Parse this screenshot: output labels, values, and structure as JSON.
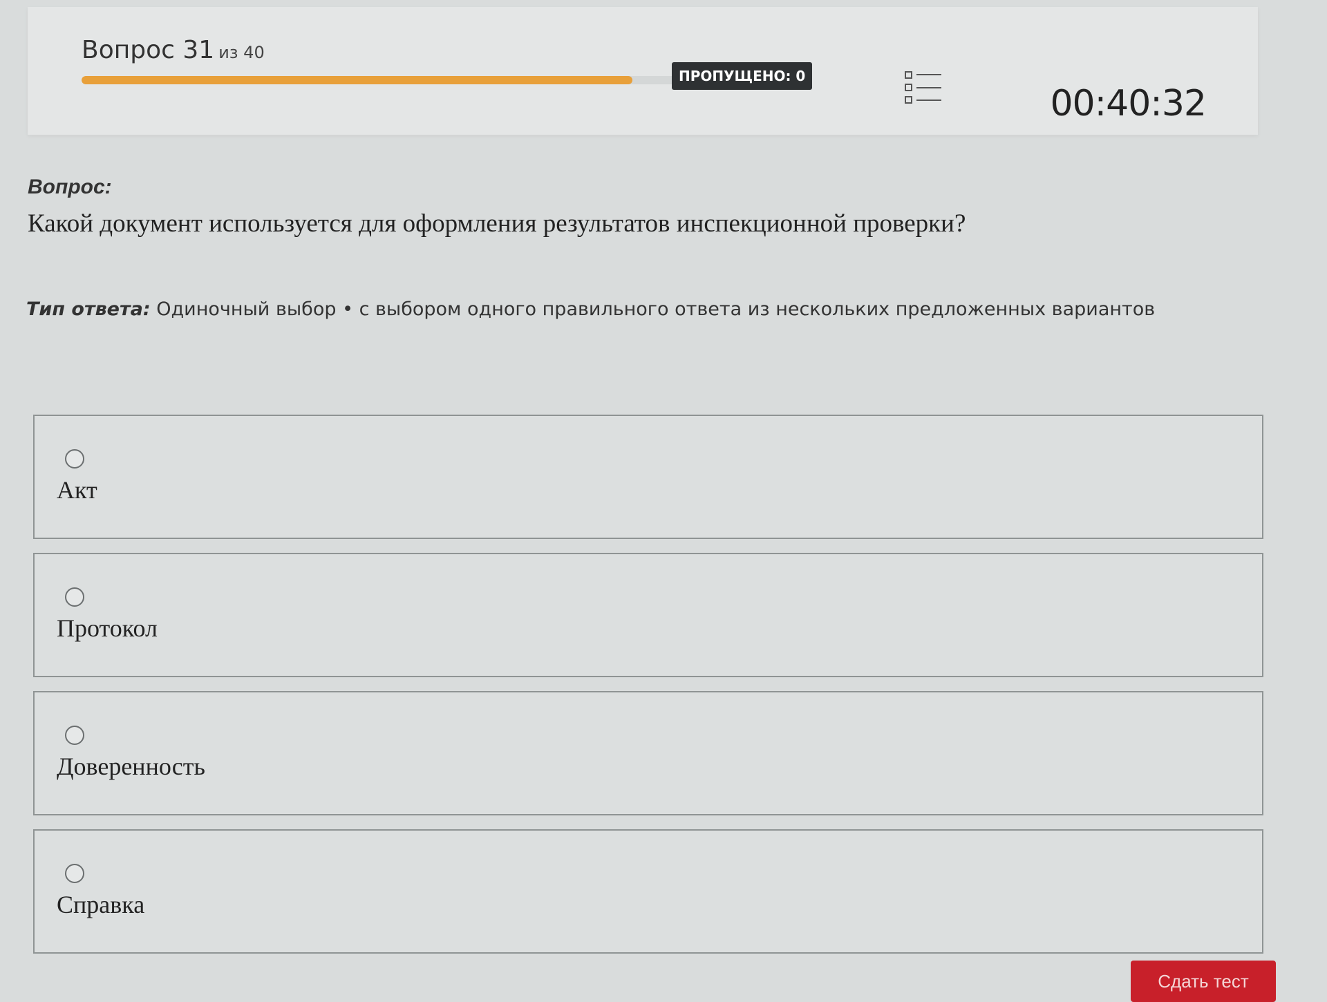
{
  "header": {
    "question_prefix": "Вопрос 31",
    "question_of": "из 40",
    "progress": 0.77,
    "skipped_label": "ПРОПУЩЕНО: 0",
    "list_icon": "question-list-icon",
    "timer": "00:40:32",
    "accent_color": "#e8a03a"
  },
  "question": {
    "label": "Вопрос:",
    "text": "Какой документ используется для оформления результатов инспекционной проверки?"
  },
  "answer_type": {
    "label": "Тип ответа:",
    "value": "Одиночный выбор • с выбором одного правильного ответа из нескольких предложенных вариантов"
  },
  "options": [
    {
      "label": "Акт",
      "selected": false
    },
    {
      "label": "Протокол",
      "selected": false
    },
    {
      "label": "Доверенность",
      "selected": false
    },
    {
      "label": "Справка",
      "selected": false
    }
  ],
  "submit": {
    "label": "Сдать тест",
    "color": "#c8202a"
  }
}
